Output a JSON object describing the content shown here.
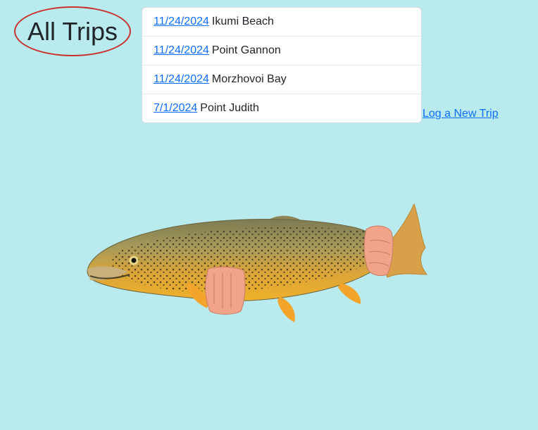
{
  "header": {
    "title": "All Trips"
  },
  "trips": [
    {
      "date": "11/24/2024",
      "location": "Ikumi Beach"
    },
    {
      "date": "11/24/2024",
      "location": "Point Gannon"
    },
    {
      "date": "11/24/2024",
      "location": "Morzhovoi Bay"
    },
    {
      "date": "7/1/2024",
      "location": "Point Judith"
    }
  ],
  "actions": {
    "new_trip_label": "Log a New Trip"
  },
  "image": {
    "subject": "brown-trout-photo"
  },
  "colors": {
    "background": "#b9eaed",
    "link": "#0d6efd",
    "oval_border": "#c9302c",
    "list_background": "#ffffff"
  }
}
